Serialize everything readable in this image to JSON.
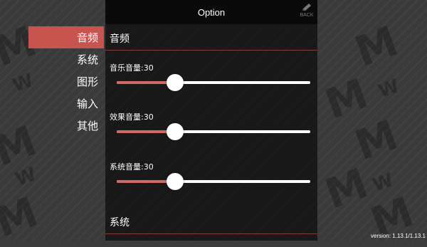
{
  "header": {
    "title": "Option",
    "back_label": "BACK",
    "back_icon": "pencil-icon"
  },
  "sidebar": {
    "items": [
      {
        "label": "音频",
        "active": true
      },
      {
        "label": "系统",
        "active": false
      },
      {
        "label": "图形",
        "active": false
      },
      {
        "label": "输入",
        "active": false
      },
      {
        "label": "其他",
        "active": false
      }
    ]
  },
  "main": {
    "section_audio": {
      "title": "音频"
    },
    "sliders": [
      {
        "label": "音乐音量:30",
        "value": 30
      },
      {
        "label": "效果音量:30",
        "value": 30
      },
      {
        "label": "系统音量:30",
        "value": 30
      }
    ],
    "section_system": {
      "title": "系统"
    }
  },
  "footer": {
    "version": "version: 1.13.1/1.13.1"
  },
  "colors": {
    "accent": "#c85450",
    "slider_fill": "#d06a66",
    "panel_bg": "#000000",
    "header_bg": "#0a0a0a"
  }
}
